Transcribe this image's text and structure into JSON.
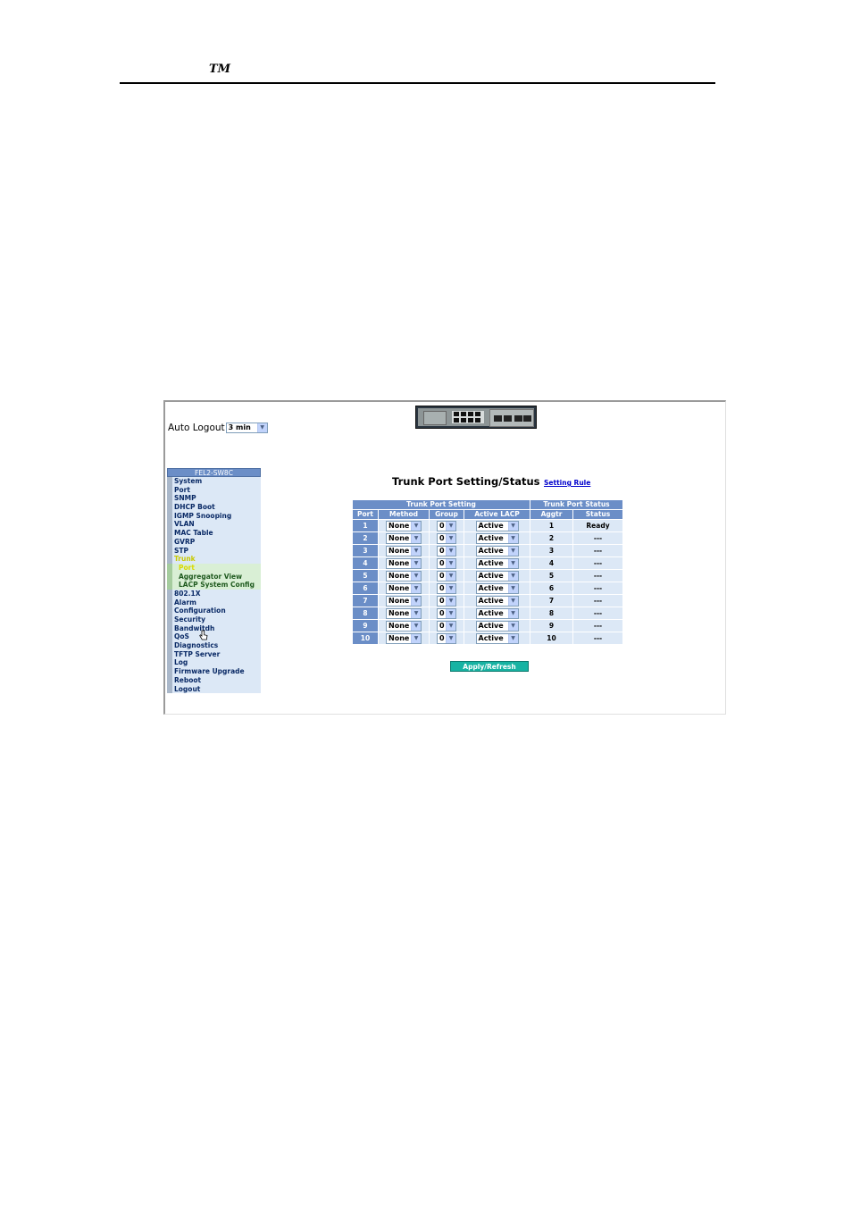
{
  "doc": {
    "trademark": "TM"
  },
  "auto_logout": {
    "label": "Auto Logout",
    "value": "3 min"
  },
  "nav": {
    "header": "FEL2-SW8C",
    "items": [
      {
        "label": "System",
        "type": "item",
        "active": false
      },
      {
        "label": "Port",
        "type": "item",
        "active": false
      },
      {
        "label": "SNMP",
        "type": "item",
        "active": false
      },
      {
        "label": "DHCP Boot",
        "type": "item",
        "active": false
      },
      {
        "label": "IGMP Snooping",
        "type": "item",
        "active": false
      },
      {
        "label": "VLAN",
        "type": "item",
        "active": false
      },
      {
        "label": "MAC Table",
        "type": "item",
        "active": false
      },
      {
        "label": "GVRP",
        "type": "item",
        "active": false
      },
      {
        "label": "STP",
        "type": "item",
        "active": false
      },
      {
        "label": "Trunk",
        "type": "item",
        "active": true
      },
      {
        "label": "Port",
        "type": "sub",
        "active": true
      },
      {
        "label": "Aggregator View",
        "type": "sub",
        "active": false
      },
      {
        "label": "LACP System Config",
        "type": "sub",
        "active": false
      },
      {
        "label": "802.1X",
        "type": "item",
        "active": false
      },
      {
        "label": "Alarm",
        "type": "item",
        "active": false
      },
      {
        "label": "Configuration",
        "type": "item",
        "active": false
      },
      {
        "label": "Security",
        "type": "item",
        "active": false
      },
      {
        "label": "Bandwitdh",
        "type": "item",
        "active": false
      },
      {
        "label": "QoS",
        "type": "item",
        "active": false
      },
      {
        "label": "Diagnostics",
        "type": "item",
        "active": false
      },
      {
        "label": "TFTP Server",
        "type": "item",
        "active": false
      },
      {
        "label": "Log",
        "type": "item",
        "active": false
      },
      {
        "label": "Firmware Upgrade",
        "type": "item",
        "active": false
      },
      {
        "label": "Reboot",
        "type": "item",
        "active": false
      },
      {
        "label": "Logout",
        "type": "item",
        "active": false
      }
    ]
  },
  "main": {
    "title": "Trunk Port Setting/Status",
    "setting_rule_link": "Setting Rule",
    "table": {
      "group_headers": {
        "setting": "Trunk Port Setting",
        "status": "Trunk Port Status"
      },
      "columns": {
        "port": "Port",
        "method": "Method",
        "group": "Group",
        "active_lacp": "Active LACP",
        "aggtr": "Aggtr",
        "status": "Status"
      },
      "rows": [
        {
          "port": "1",
          "method": "None",
          "group": "0",
          "lacp": "Active",
          "aggtr": "1",
          "status": "Ready"
        },
        {
          "port": "2",
          "method": "None",
          "group": "0",
          "lacp": "Active",
          "aggtr": "2",
          "status": "---"
        },
        {
          "port": "3",
          "method": "None",
          "group": "0",
          "lacp": "Active",
          "aggtr": "3",
          "status": "---"
        },
        {
          "port": "4",
          "method": "None",
          "group": "0",
          "lacp": "Active",
          "aggtr": "4",
          "status": "---"
        },
        {
          "port": "5",
          "method": "None",
          "group": "0",
          "lacp": "Active",
          "aggtr": "5",
          "status": "---"
        },
        {
          "port": "6",
          "method": "None",
          "group": "0",
          "lacp": "Active",
          "aggtr": "6",
          "status": "---"
        },
        {
          "port": "7",
          "method": "None",
          "group": "0",
          "lacp": "Active",
          "aggtr": "7",
          "status": "---"
        },
        {
          "port": "8",
          "method": "None",
          "group": "0",
          "lacp": "Active",
          "aggtr": "8",
          "status": "---"
        },
        {
          "port": "9",
          "method": "None",
          "group": "0",
          "lacp": "Active",
          "aggtr": "9",
          "status": "---"
        },
        {
          "port": "10",
          "method": "None",
          "group": "0",
          "lacp": "Active",
          "aggtr": "10",
          "status": "---"
        }
      ]
    },
    "apply_button": "Apply/Refresh"
  },
  "icons": {
    "dropdown": "chevron-down-icon",
    "cursor": "hand-pointer-icon",
    "device": "switch-front-panel-icon"
  },
  "colors": {
    "header_blue": "#6b8ec7",
    "cell_blue": "#dce8f6",
    "apply_teal": "#17b3a3",
    "active_yellow": "#c8c800"
  }
}
